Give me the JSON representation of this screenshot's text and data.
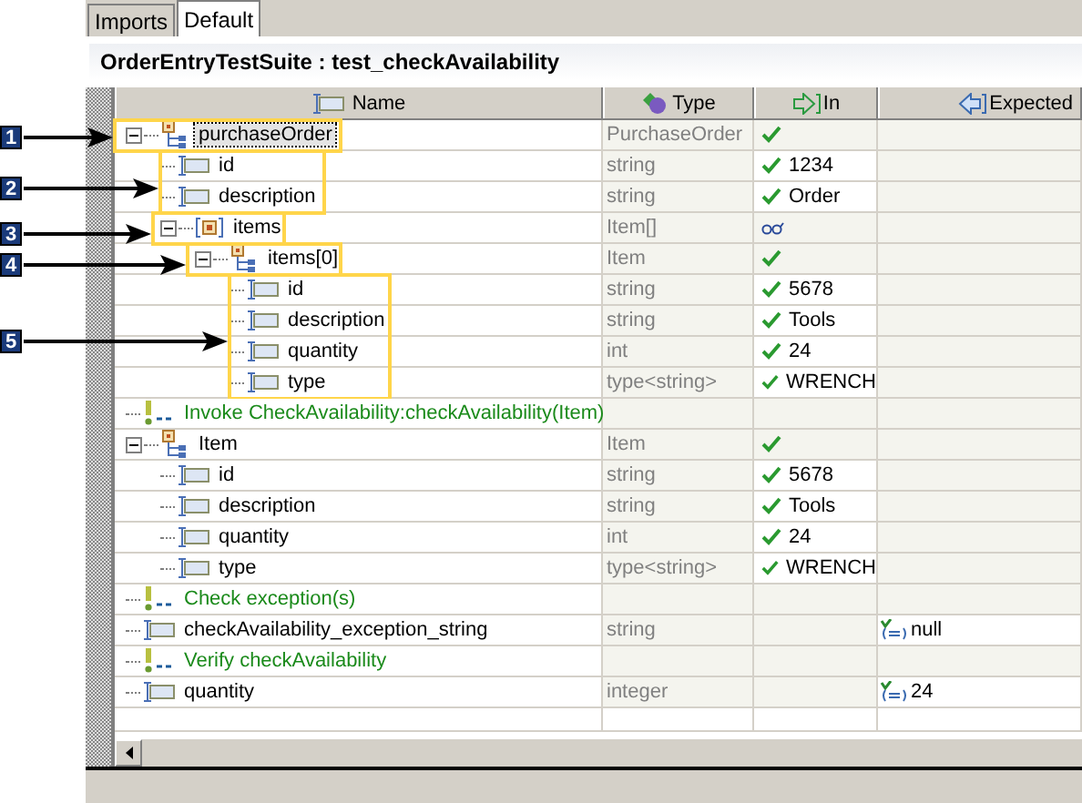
{
  "tabs": [
    {
      "label": "Imports",
      "selected": false
    },
    {
      "label": "Default",
      "selected": true
    }
  ],
  "title": "OrderEntryTestSuite : test_checkAvailability",
  "columns": [
    "Name",
    "Type",
    "In",
    "Expected"
  ],
  "rows": [
    {
      "name": "purchaseOrder",
      "kind": "complex",
      "type": "PurchaseOrder",
      "in": {
        "kind": "check"
      },
      "expanded": true,
      "selected": true,
      "children": [
        {
          "name": "id",
          "kind": "field",
          "type": "string",
          "in": {
            "kind": "check",
            "value": "1234"
          },
          "selected": false
        },
        {
          "name": "description",
          "kind": "field",
          "type": "string",
          "in": {
            "kind": "check",
            "value": "Order"
          },
          "selected": false
        },
        {
          "name": "items",
          "kind": "array",
          "type": "Item[]",
          "in": {
            "kind": "glasses"
          },
          "expanded": true,
          "selected": false,
          "children": [
            {
              "name": "items[0]",
              "kind": "complex",
              "type": "Item",
              "in": {
                "kind": "check"
              },
              "expanded": true,
              "selected": false,
              "children": [
                {
                  "name": "id",
                  "kind": "field",
                  "type": "string",
                  "in": {
                    "kind": "check",
                    "value": "5678"
                  },
                  "selected": false
                },
                {
                  "name": "description",
                  "kind": "field",
                  "type": "string",
                  "in": {
                    "kind": "check",
                    "value": "Tools"
                  },
                  "selected": false
                },
                {
                  "name": "quantity",
                  "kind": "field",
                  "type": "int",
                  "in": {
                    "kind": "check",
                    "value": "24"
                  },
                  "selected": false
                },
                {
                  "name": "type",
                  "kind": "field",
                  "type": "type<string>",
                  "in": {
                    "kind": "check",
                    "value": "WRENCH"
                  },
                  "selected": false
                }
              ]
            }
          ]
        }
      ]
    },
    {
      "name": "Invoke CheckAvailability:checkAvailability(Item)",
      "kind": "comment",
      "selected": false
    },
    {
      "name": "Item",
      "kind": "complex",
      "type": "Item",
      "in": {
        "kind": "check"
      },
      "expanded": true,
      "selected": false,
      "children": [
        {
          "name": "id",
          "kind": "field",
          "type": "string",
          "in": {
            "kind": "check",
            "value": "5678"
          },
          "selected": false
        },
        {
          "name": "description",
          "kind": "field",
          "type": "string",
          "in": {
            "kind": "check",
            "value": "Tools"
          },
          "selected": false
        },
        {
          "name": "quantity",
          "kind": "field",
          "type": "int",
          "in": {
            "kind": "check",
            "value": "24"
          },
          "selected": false
        },
        {
          "name": "type",
          "kind": "field",
          "type": "type<string>",
          "in": {
            "kind": "check",
            "value": "WRENCH"
          },
          "selected": false
        }
      ]
    },
    {
      "name": "Check exception(s)",
      "kind": "comment",
      "selected": false
    },
    {
      "name": "checkAvailability_exception_string",
      "kind": "field",
      "type": "string",
      "expected": {
        "kind": "compare",
        "value": "null"
      },
      "selected": false
    },
    {
      "name": "Verify checkAvailability",
      "kind": "comment",
      "selected": false
    },
    {
      "name": "quantity",
      "kind": "field",
      "type": "integer",
      "expected": {
        "kind": "compare",
        "value": "24"
      },
      "selected": false
    }
  ],
  "callouts": [
    "1",
    "2",
    "3",
    "4",
    "5"
  ]
}
